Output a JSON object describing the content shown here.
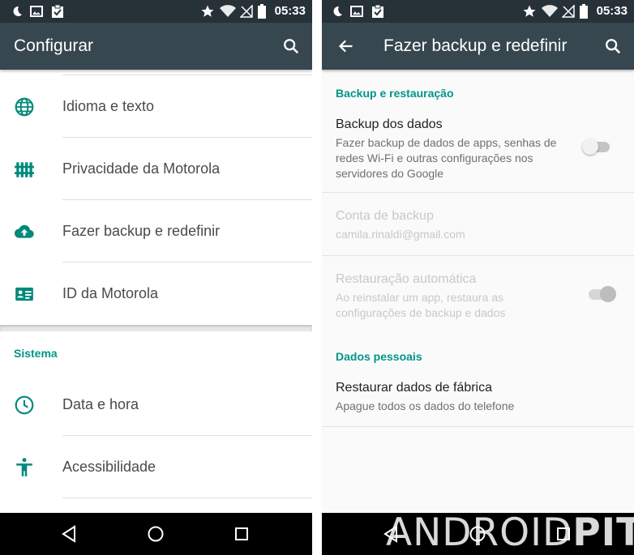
{
  "status_bar": {
    "time": "05:33",
    "left_icons": [
      "moon-icon",
      "image-icon",
      "clipboard-check-icon"
    ],
    "right_icons": [
      "star-icon",
      "wifi-icon",
      "no-signal-icon",
      "battery-icon"
    ]
  },
  "left_screen": {
    "title": "Configurar",
    "items_top": [
      {
        "label": "Idioma e texto",
        "icon": "globe-icon"
      },
      {
        "label": "Privacidade da Motorola",
        "icon": "fence-icon"
      },
      {
        "label": "Fazer backup e redefinir",
        "icon": "cloud-upload-icon"
      },
      {
        "label": "ID da Motorola",
        "icon": "id-card-icon"
      }
    ],
    "section": "Sistema",
    "items_bottom": [
      {
        "label": "Data e hora",
        "icon": "clock-icon"
      },
      {
        "label": "Acessibilidade",
        "icon": "accessibility-icon"
      }
    ]
  },
  "right_screen": {
    "title": "Fazer backup e redefinir",
    "section_backup": "Backup e restauração",
    "backup_data": {
      "title": "Backup dos dados",
      "summary": "Fazer backup de dados de apps, senhas de redes Wi-Fi e outras configurações nos servidores do Google",
      "enabled": false
    },
    "backup_account": {
      "title": "Conta de backup",
      "summary": "camila.rinaldi@gmail.com"
    },
    "auto_restore": {
      "title": "Restauração automática",
      "summary": "Ao reinstalar um app, restaura as configurações de backup e dados",
      "enabled": true
    },
    "section_personal": "Dados pessoais",
    "factory_reset": {
      "title": "Restaurar dados de fábrica",
      "summary": "Apague todos os dados do telefone"
    }
  },
  "nav_bar": [
    "back-icon",
    "home-icon",
    "recents-icon"
  ],
  "watermark": {
    "part1": "ANDROID",
    "part2": "PIT"
  },
  "colors": {
    "status_bar": "#263238",
    "app_bar": "#37474f",
    "accent": "#009688",
    "switch_off_track": "#c4c4c4",
    "switch_off_thumb": "#f1f1f1",
    "switch_disabled": "#bdbdbd"
  }
}
